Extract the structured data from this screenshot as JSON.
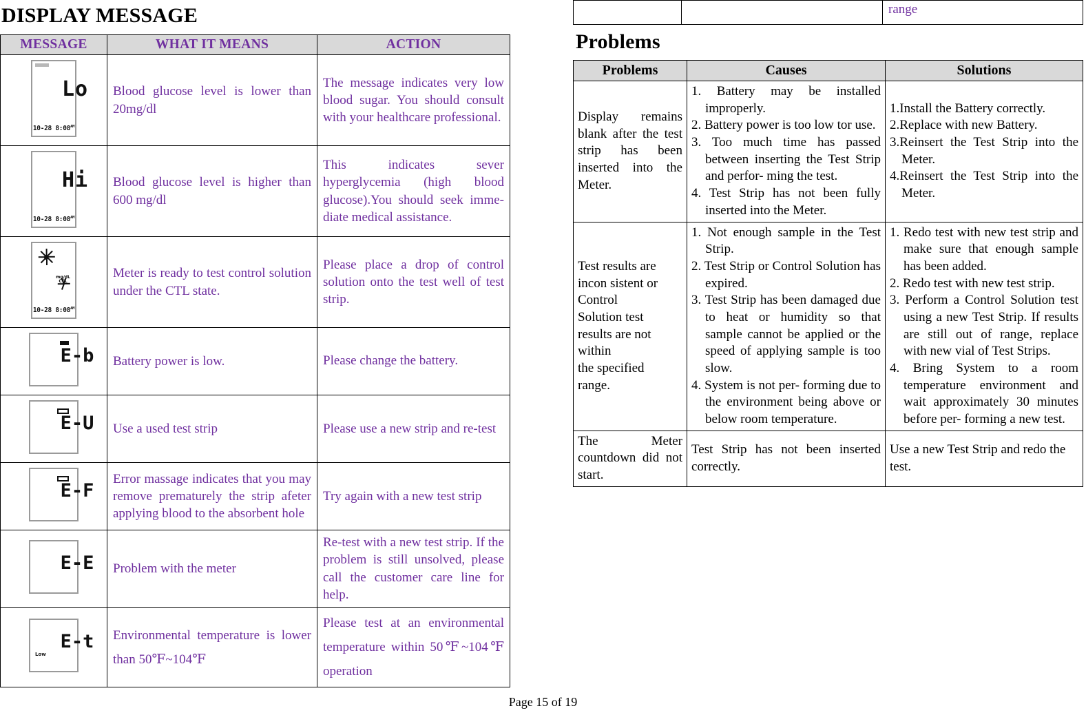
{
  "left": {
    "title": "DISPLAY MESSAGE",
    "table": {
      "headers": [
        "MESSAGE",
        "WHAT IT MEANS",
        "ACTION"
      ],
      "rows": [
        {
          "display": {
            "type": "lcd-tall",
            "main": "Lo",
            "timestamp": "10-28  8:08",
            "timestamp_suffix": "AM"
          },
          "meaning": "Blood glucose level is lower than 20mg/dl",
          "action": "The message indicates very low blood sugar. You should consult with your healthcare professional."
        },
        {
          "display": {
            "type": "lcd-tall",
            "main": "Hi",
            "timestamp": "10-28  8:08",
            "timestamp_suffix": "AM"
          },
          "meaning": "Blood glucose level is higher than 600 mg/dl",
          "action": "This indicates sever hyperglycemia (high blood glucose).You should seek imme- diate medical assistance."
        },
        {
          "display": {
            "type": "lcd-ctl",
            "ctl_label_top": "mg/dL",
            "ctl_label_bottom": "CTL",
            "timestamp": "10-28  8:08",
            "timestamp_suffix": "AM"
          },
          "meaning": "Meter is ready to test control solution under the CTL state.",
          "action": "Please place a drop of control solution onto the test well of test strip."
        },
        {
          "display": {
            "type": "lcd-err",
            "main": "E-b",
            "mark": "filled"
          },
          "meaning": "Battery power is low.",
          "action": "Please change the battery."
        },
        {
          "display": {
            "type": "lcd-err",
            "main": "E-U",
            "mark": "hollow"
          },
          "meaning": "Use a used test strip",
          "action": "Please use a new strip and re-test"
        },
        {
          "display": {
            "type": "lcd-err",
            "main": "E-F",
            "mark": "hollow"
          },
          "meaning": "Error massage indicates that you may remove prematurely the strip afeter applying blood to the absorbent hole",
          "action": "Try again with a new test strip"
        },
        {
          "display": {
            "type": "lcd-err",
            "main": "E-E",
            "mark": "none"
          },
          "meaning": "Problem with the meter",
          "action": "Re-test with a new test strip. If the problem is still unsolved, please call the customer care line for help."
        },
        {
          "display": {
            "type": "lcd-err",
            "main": "E-t",
            "mark": "none",
            "mini_label": "Low"
          },
          "meaning": "Environmental temperature is lower than 50℉~104℉",
          "action": "Please test at an environmental temperature within 50℉~104℉ operation"
        }
      ]
    }
  },
  "right": {
    "continued_table": {
      "cells": [
        "",
        "",
        "range"
      ]
    },
    "title": "Problems",
    "table": {
      "headers": [
        "Problems",
        "Causes",
        "Solutions"
      ],
      "rows": [
        {
          "problem": "Display remains blank after the test strip has been inserted into the Meter.",
          "causes": [
            "1. Battery may be installed improperly.",
            "2. Battery power is too low tor use.",
            "3. Too much time has passed between inserting the Test Strip and perfor- ming the test.",
            "4. Test Strip has not been fully inserted into the Meter."
          ],
          "solutions": [
            "1.Install the Battery correctly.",
            "2.Replace with new Battery.",
            "3.Reinsert the Test Strip into the Meter.",
            "4.Reinsert the Test Strip into the Meter."
          ]
        },
        {
          "problem_lines": [
            "Test results are",
            "incon sistent or",
            "Control",
            "Solution  test",
            "results  are  not",
            "within",
            "the    specified",
            "range."
          ],
          "causes": [
            "1. Not enough sample in the Test Strip.",
            "2. Test Strip or Control Solution has expired.",
            "3. Test Strip has been damaged due to heat or humidity so that sample cannot be applied or the speed of applying sample is too slow.",
            "4. System is not per- forming due to the environment being above or below room temperature."
          ],
          "solutions": [
            "1. Redo test with new test strip and make sure that enough sample has been added.",
            "2. Redo test with new test strip.",
            "3. Perform a Control Solution test using a new Test Strip. If results are still out of range, replace with new vial of Test Strips.",
            "4. Bring System to a room temperature environment and wait approximately 30 minutes before per- forming a new test."
          ]
        },
        {
          "problem": "The Meter countdown did not start.",
          "causes_plain": "Test Strip has not been inserted correctly.",
          "solutions_plain": "Use a new Test Strip and redo the test."
        }
      ]
    }
  },
  "footer": {
    "page_label": "Page 15 of 19"
  },
  "colors": {
    "accent_purple": "#6f2f9f",
    "header_gray": "#d9d9d9",
    "border_black": "#000000"
  }
}
